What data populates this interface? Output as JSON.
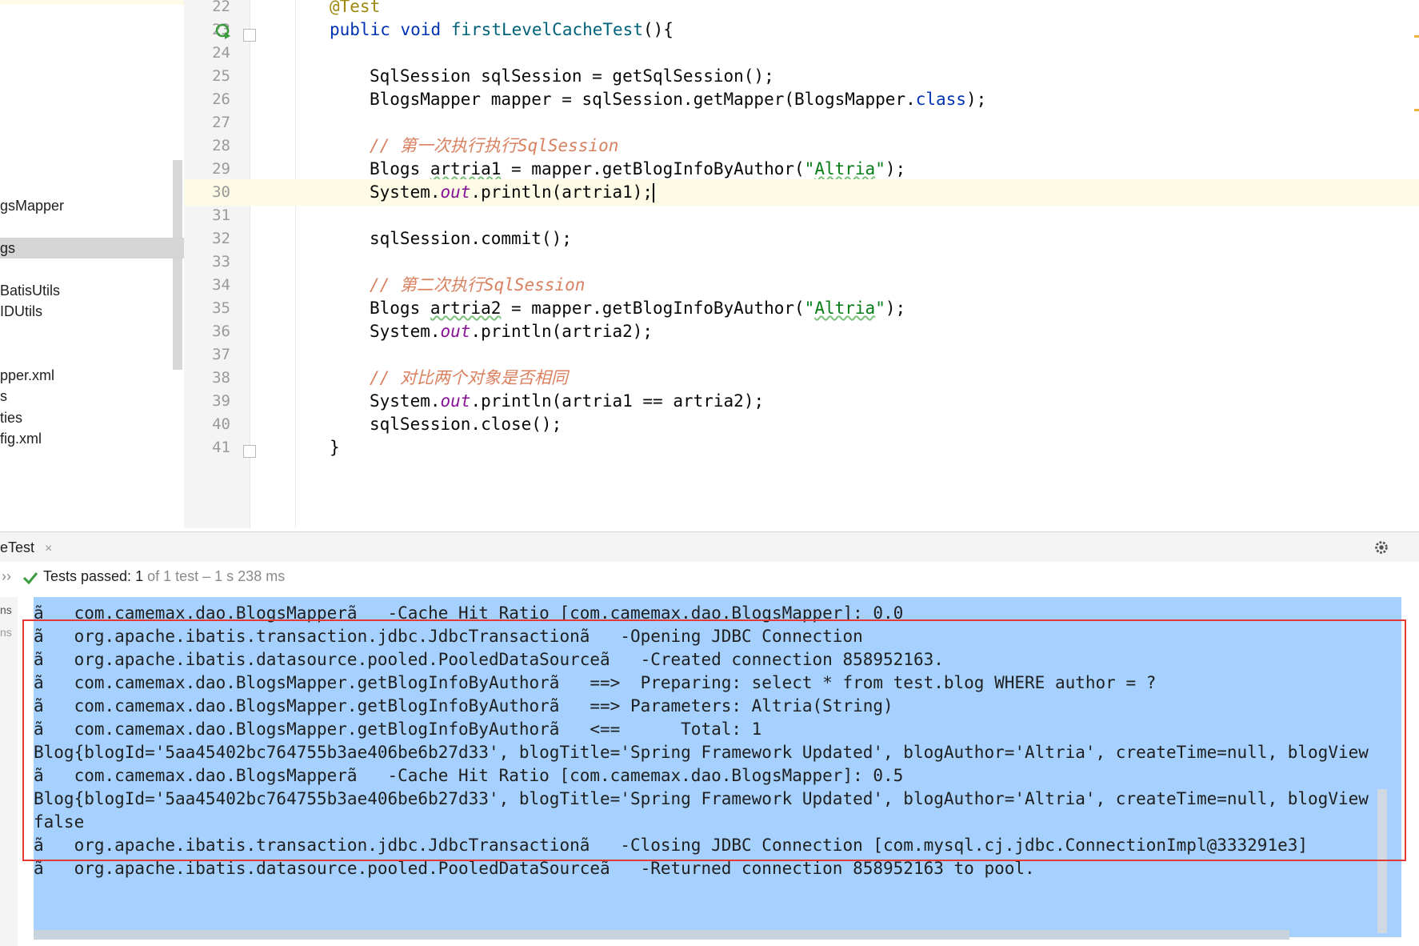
{
  "project_tree": {
    "items": [
      {
        "label": "gsMapper",
        "selected": false
      },
      {
        "label": "gs",
        "selected": true
      },
      {
        "label": "BatisUtils",
        "selected": false
      },
      {
        "label": "IDUtils",
        "selected": false
      },
      {
        "label": "pper.xml",
        "selected": false
      },
      {
        "label": "s",
        "selected": false
      },
      {
        "label": "ties",
        "selected": false
      },
      {
        "label": "fig.xml",
        "selected": false
      }
    ]
  },
  "editor": {
    "current_line": "30",
    "lines": [
      {
        "n": "22",
        "code": "@Test"
      },
      {
        "n": "23",
        "code": "public void firstLevelCacheTest(){"
      },
      {
        "n": "24",
        "code": ""
      },
      {
        "n": "25",
        "code": "SqlSession sqlSession = getSqlSession();"
      },
      {
        "n": "26",
        "code": "BlogsMapper mapper = sqlSession.getMapper(BlogsMapper.class);"
      },
      {
        "n": "27",
        "code": ""
      },
      {
        "n": "28",
        "code": "// 第一次执行执行SqlSession"
      },
      {
        "n": "29",
        "code": "Blogs artria1 = mapper.getBlogInfoByAuthor(\"Altria\");"
      },
      {
        "n": "30",
        "code": "System.out.println(artria1);"
      },
      {
        "n": "31",
        "code": ""
      },
      {
        "n": "32",
        "code": "sqlSession.commit();"
      },
      {
        "n": "33",
        "code": ""
      },
      {
        "n": "34",
        "code": "// 第二次执行SqlSession"
      },
      {
        "n": "35",
        "code": "Blogs artria2 = mapper.getBlogInfoByAuthor(\"Altria\");"
      },
      {
        "n": "36",
        "code": "System.out.println(artria2);"
      },
      {
        "n": "37",
        "code": ""
      },
      {
        "n": "38",
        "code": "// 对比两个对象是否相同"
      },
      {
        "n": "39",
        "code": "System.out.println(artria1 == artria2);"
      },
      {
        "n": "40",
        "code": "sqlSession.close();"
      },
      {
        "n": "41",
        "code": "}"
      }
    ]
  },
  "run_panel": {
    "tab_label": "eTest",
    "tab_close": "×",
    "status_prefix": "Tests passed:",
    "status_count": "1",
    "status_rest": "of 1 test – 1 s 238 ms",
    "side_labels": [
      "ns",
      "ns"
    ],
    "console_lines": [
      "ã   com.camemax.dao.BlogsMapperã   -Cache Hit Ratio [com.camemax.dao.BlogsMapper]: 0.0",
      "ã   org.apache.ibatis.transaction.jdbc.JdbcTransactionã   -Opening JDBC Connection",
      "ã   org.apache.ibatis.datasource.pooled.PooledDataSourceã   -Created connection 858952163.",
      "ã   com.camemax.dao.BlogsMapper.getBlogInfoByAuthorã   ==>  Preparing: select * from test.blog WHERE author = ?",
      "ã   com.camemax.dao.BlogsMapper.getBlogInfoByAuthorã   ==> Parameters: Altria(String)",
      "ã   com.camemax.dao.BlogsMapper.getBlogInfoByAuthorã   <==      Total: 1",
      "Blog{blogId='5aa45402bc764755b3ae406be6b27d33', blogTitle='Spring Framework Updated', blogAuthor='Altria', createTime=null, blogView",
      "ã   com.camemax.dao.BlogsMapperã   -Cache Hit Ratio [com.camemax.dao.BlogsMapper]: 0.5",
      "Blog{blogId='5aa45402bc764755b3ae406be6b27d33', blogTitle='Spring Framework Updated', blogAuthor='Altria', createTime=null, blogView",
      "false",
      "ã   org.apache.ibatis.transaction.jdbc.JdbcTransactionã   -Closing JDBC Connection [com.mysql.cj.jdbc.ConnectionImpl@333291e3]",
      "ã   org.apache.ibatis.datasource.pooled.PooledDataSourceã   -Returned connection 858952163 to pool."
    ]
  },
  "colors": {
    "console_selection": "#a6d1ff",
    "highlight_box": "#e53935",
    "pass_green": "#3a9b3a"
  },
  "icons": [
    "run-test-icon",
    "fold-icon",
    "gear-icon",
    "check-icon",
    "close-icon",
    "chevron-icon"
  ]
}
